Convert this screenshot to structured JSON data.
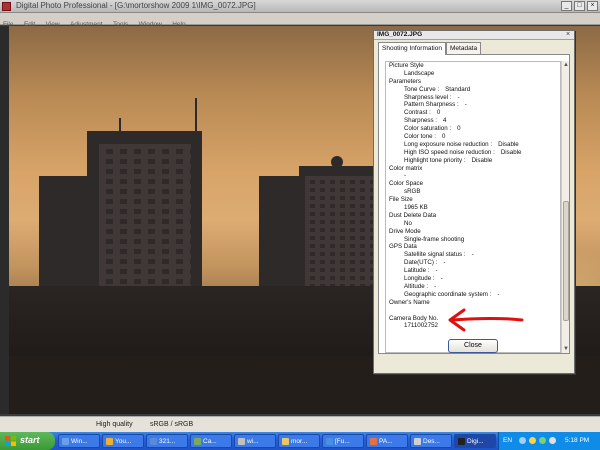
{
  "window": {
    "title": "Digital Photo Professional - [G:\\mortorshow 2009 1\\IMG_0072.JPG]",
    "menu": [
      "File",
      "Edit",
      "View",
      "Adjustment",
      "Tools",
      "Window",
      "Help"
    ]
  },
  "statusbar": {
    "quality": "High quality",
    "color_space": "sRGB / sRGB"
  },
  "info_dialog": {
    "title": "IMG_0072.JPG",
    "tabs": [
      "Shooting Information",
      "Metadata"
    ],
    "close_label": "Close",
    "rows": [
      {
        "kind": "h",
        "label": "Picture Style"
      },
      {
        "kind": "v",
        "label": "Landscape"
      },
      {
        "kind": "h",
        "label": "Parameters"
      },
      {
        "kind": "p",
        "label": "Tone Curve :",
        "value": "Standard"
      },
      {
        "kind": "p",
        "label": "Sharpness level :",
        "value": "-"
      },
      {
        "kind": "p",
        "label": "Pattern Sharpness :",
        "value": "-"
      },
      {
        "kind": "p",
        "label": "Contrast :",
        "value": "0"
      },
      {
        "kind": "p",
        "label": "Sharpness :",
        "value": "4"
      },
      {
        "kind": "p",
        "label": "Color saturation :",
        "value": "0"
      },
      {
        "kind": "p",
        "label": "Color tone :",
        "value": "0"
      },
      {
        "kind": "p",
        "label": "Long exposure noise reduction :",
        "value": "Disable"
      },
      {
        "kind": "p",
        "label": "High ISO speed noise reduction :",
        "value": "Disable"
      },
      {
        "kind": "p",
        "label": "Highlight tone priority :",
        "value": "Disable"
      },
      {
        "kind": "h",
        "label": "Color matrix"
      },
      {
        "kind": "v",
        "label": "-"
      },
      {
        "kind": "h",
        "label": "Color Space"
      },
      {
        "kind": "v",
        "label": "sRGB"
      },
      {
        "kind": "h",
        "label": "File Size"
      },
      {
        "kind": "v",
        "label": "1965 KB"
      },
      {
        "kind": "h",
        "label": "Dust Delete Data"
      },
      {
        "kind": "v",
        "label": "No"
      },
      {
        "kind": "h",
        "label": "Drive Mode"
      },
      {
        "kind": "v",
        "label": "Single-frame shooting"
      },
      {
        "kind": "h",
        "label": "GPS Data"
      },
      {
        "kind": "p",
        "label": "Satellite signal status :",
        "value": "-"
      },
      {
        "kind": "p",
        "label": "Date(UTC) :",
        "value": "-"
      },
      {
        "kind": "p",
        "label": "Latitude :",
        "value": "-"
      },
      {
        "kind": "p",
        "label": "Longitude :",
        "value": "-"
      },
      {
        "kind": "p",
        "label": "Altitude :",
        "value": "-"
      },
      {
        "kind": "p",
        "label": "Geographic coordinate system :",
        "value": "-"
      },
      {
        "kind": "h",
        "label": "Owner's Name"
      },
      {
        "kind": "v",
        "label": ""
      },
      {
        "kind": "h",
        "label": "Camera Body No."
      },
      {
        "kind": "v",
        "label": "1711002752"
      }
    ]
  },
  "taskbar": {
    "start_label": "start",
    "tasks": [
      {
        "label": "Win...",
        "color": "#6aa0e8"
      },
      {
        "label": "You...",
        "color": "#f0b030"
      },
      {
        "label": "321...",
        "color": "#5a8ad8"
      },
      {
        "label": "Ca...",
        "color": "#7aaa5a"
      },
      {
        "label": "wi...",
        "color": "#c0c0c0"
      },
      {
        "label": "mor...",
        "color": "#e8c860"
      },
      {
        "label": "[Fu...",
        "color": "#4a90e2"
      },
      {
        "label": "PA...",
        "color": "#e87040"
      },
      {
        "label": "Des...",
        "color": "#d0d0d0"
      },
      {
        "label": "Digi...",
        "color": "#222222"
      }
    ],
    "active_task_index": 9,
    "tray_lang": "EN",
    "clock": "5:18 PM"
  },
  "colors": {
    "annotation_arrow": "#e01010",
    "taskbar": "#245edb",
    "start": "#3a9a35"
  }
}
